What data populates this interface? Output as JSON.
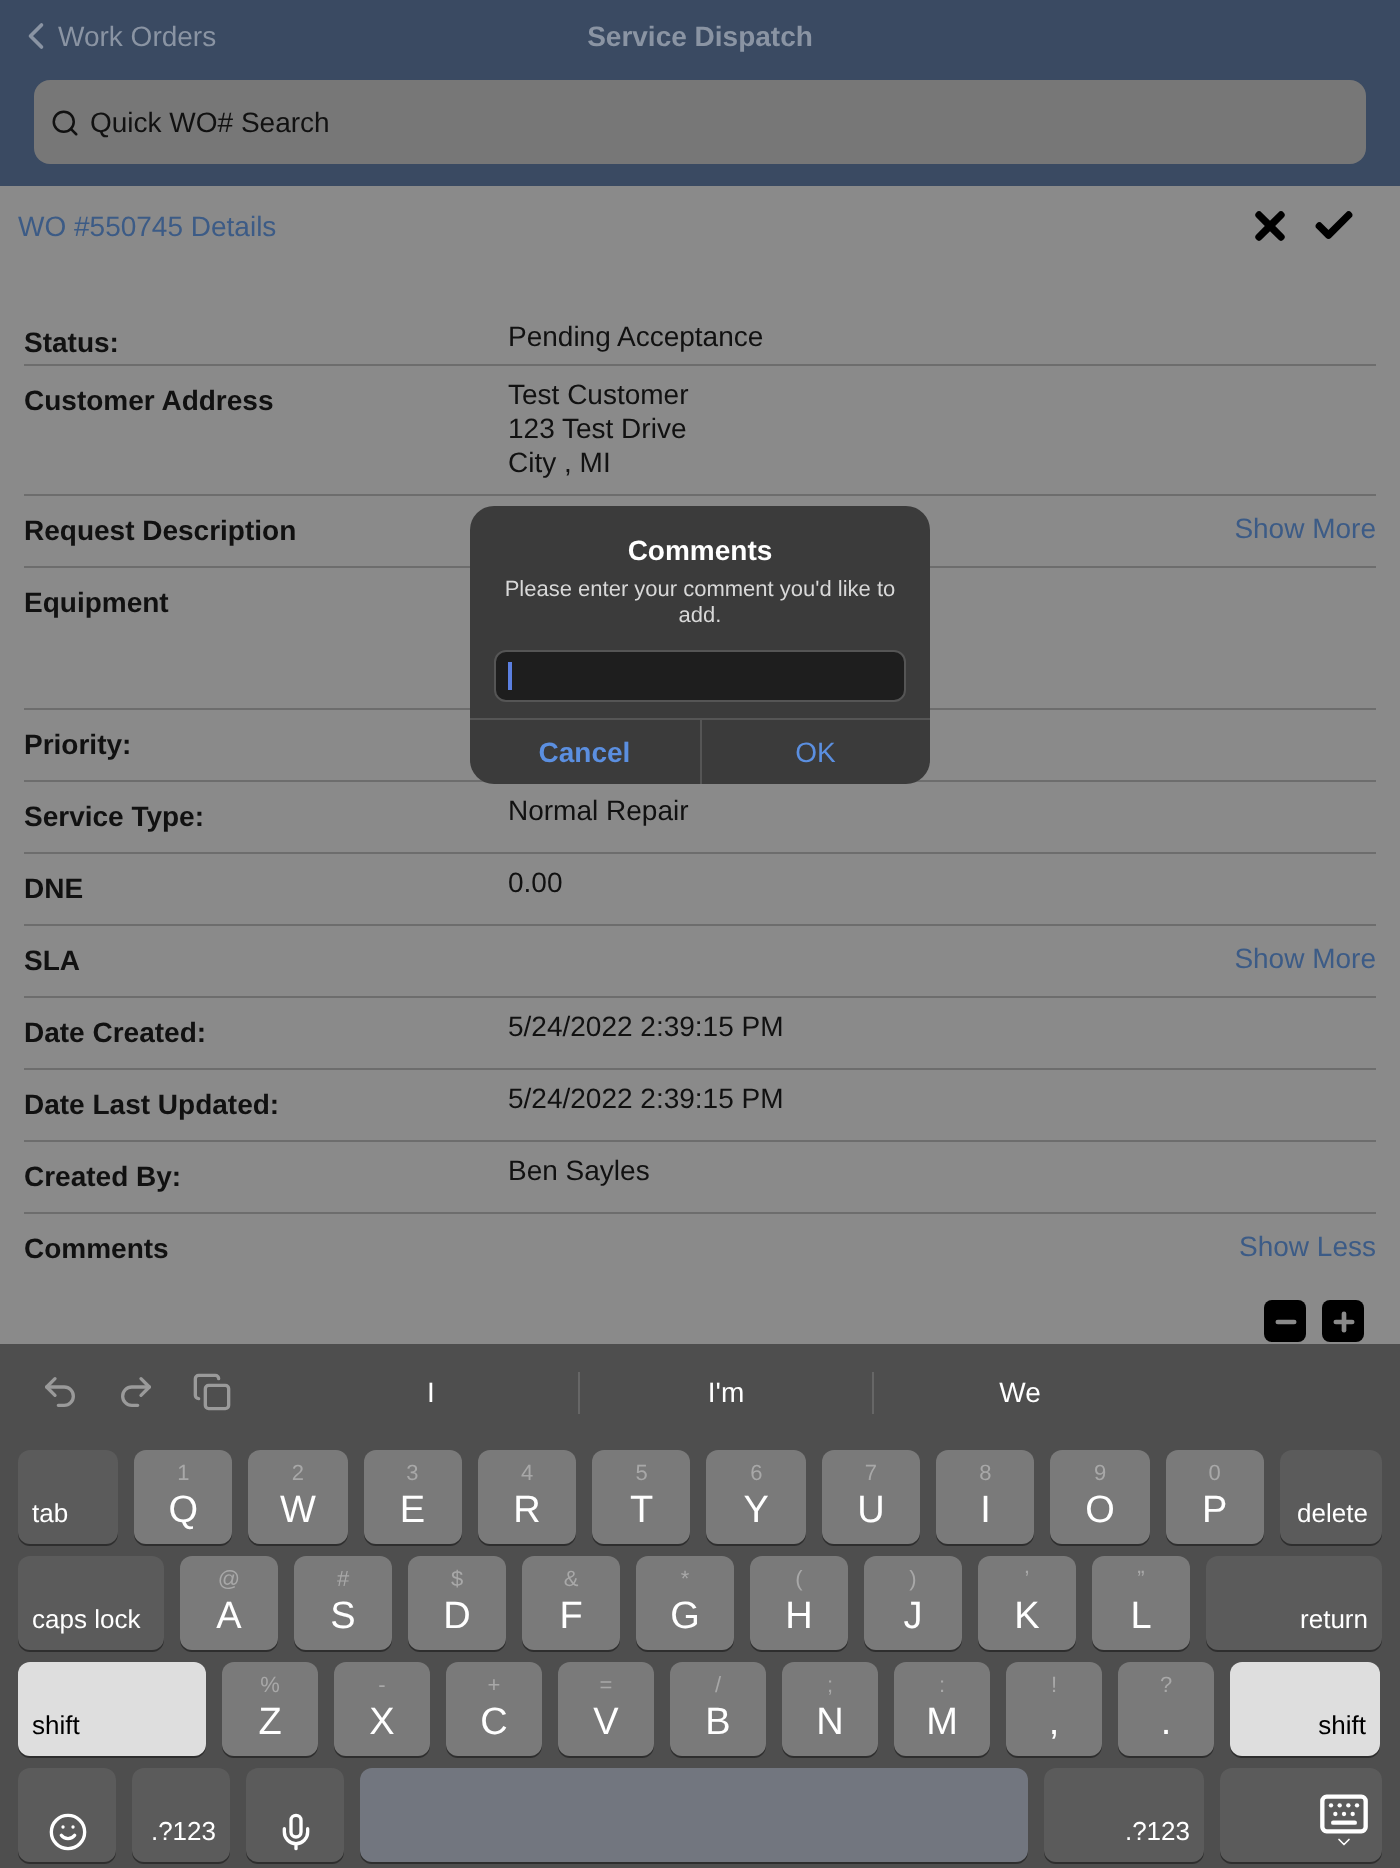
{
  "nav": {
    "back": "Work Orders",
    "title": "Service Dispatch"
  },
  "search": {
    "placeholder": "Quick WO# Search"
  },
  "details": {
    "title": "WO #550745 Details",
    "rows": [
      {
        "label": "Status:",
        "values": [
          "Pending Acceptance"
        ]
      },
      {
        "label": "Customer Address",
        "values": [
          "Test Customer",
          "123 Test Drive",
          "City , MI"
        ]
      },
      {
        "label": "Request Description",
        "link": "Show More"
      },
      {
        "label": "Equipment"
      },
      {
        "label": "Priority:"
      },
      {
        "label": "Service Type:",
        "values": [
          "Normal Repair"
        ]
      },
      {
        "label": "DNE",
        "values": [
          "0.00"
        ]
      },
      {
        "label": "SLA",
        "link": "Show More"
      },
      {
        "label": "Date Created:",
        "values": [
          "5/24/2022 2:39:15 PM"
        ]
      },
      {
        "label": "Date Last Updated:",
        "values": [
          "5/24/2022 2:39:15 PM"
        ]
      },
      {
        "label": "Created By:",
        "values": [
          "Ben Sayles"
        ]
      },
      {
        "label": "Comments",
        "link": "Show Less"
      }
    ]
  },
  "dialog": {
    "title": "Comments",
    "message": "Please enter your comment you'd like to add.",
    "buttons": [
      {
        "label": "Cancel",
        "kind": "cancel"
      },
      {
        "label": "OK",
        "kind": "ok"
      }
    ]
  },
  "suggestions": [
    "I",
    "I'm",
    "We"
  ],
  "keyboard": [
    [
      {
        "kind": "function",
        "label": "tab"
      },
      {
        "kind": "letter",
        "label": "Q",
        "alt": "1"
      },
      {
        "kind": "letter",
        "label": "W",
        "alt": "2"
      },
      {
        "kind": "letter",
        "label": "E",
        "alt": "3"
      },
      {
        "kind": "letter",
        "label": "R",
        "alt": "4"
      },
      {
        "kind": "letter",
        "label": "T",
        "alt": "5"
      },
      {
        "kind": "letter",
        "label": "Y",
        "alt": "6"
      },
      {
        "kind": "letter",
        "label": "U",
        "alt": "7"
      },
      {
        "kind": "letter",
        "label": "I",
        "alt": "8"
      },
      {
        "kind": "letter",
        "label": "O",
        "alt": "9"
      },
      {
        "kind": "letter",
        "label": "P",
        "alt": "0"
      },
      {
        "kind": "function",
        "label": "delete"
      }
    ],
    [
      {
        "kind": "function",
        "label": "caps lock"
      },
      {
        "kind": "letter",
        "label": "A",
        "alt": "@"
      },
      {
        "kind": "letter",
        "label": "S",
        "alt": "#"
      },
      {
        "kind": "letter",
        "label": "D",
        "alt": "$"
      },
      {
        "kind": "letter",
        "label": "F",
        "alt": "&"
      },
      {
        "kind": "letter",
        "label": "G",
        "alt": "*"
      },
      {
        "kind": "letter",
        "label": "H",
        "alt": "("
      },
      {
        "kind": "letter",
        "label": "J",
        "alt": ")"
      },
      {
        "kind": "letter",
        "label": "K",
        "alt": "’"
      },
      {
        "kind": "letter",
        "label": "L",
        "alt": "”"
      },
      {
        "kind": "function",
        "label": "return"
      }
    ],
    [
      {
        "kind": "function",
        "label": "shift",
        "on": true
      },
      {
        "kind": "letter",
        "label": "Z",
        "alt": "%"
      },
      {
        "kind": "letter",
        "label": "X",
        "alt": "-"
      },
      {
        "kind": "letter",
        "label": "C",
        "alt": "+"
      },
      {
        "kind": "letter",
        "label": "V",
        "alt": "="
      },
      {
        "kind": "letter",
        "label": "B",
        "alt": "/"
      },
      {
        "kind": "letter",
        "label": "N",
        "alt": ";"
      },
      {
        "kind": "letter",
        "label": "M",
        "alt": ":"
      },
      {
        "kind": "letter",
        "label": ",",
        "alt": "!"
      },
      {
        "kind": "letter",
        "label": ".",
        "alt": "?"
      },
      {
        "kind": "function",
        "label": "shift",
        "on": true
      }
    ],
    [
      {
        "kind": "emoji"
      },
      {
        "kind": "function",
        "label": ".?123"
      },
      {
        "kind": "dictation"
      },
      {
        "kind": "space"
      },
      {
        "kind": "function",
        "label": ".?123"
      },
      {
        "kind": "dismiss"
      }
    ]
  ]
}
